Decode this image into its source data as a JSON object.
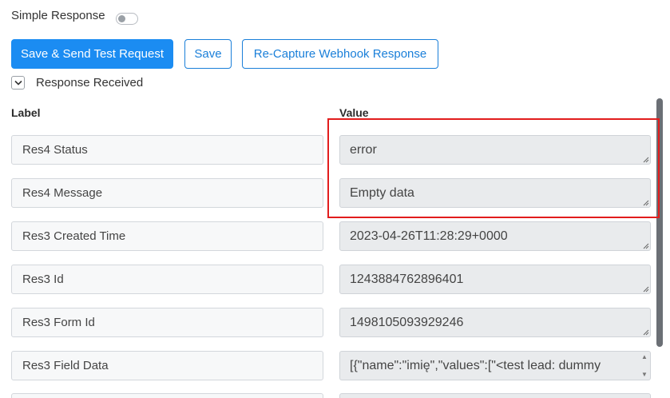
{
  "simple_response": {
    "label": "Simple Response",
    "enabled": false
  },
  "buttons": {
    "save_send": "Save & Send Test Request",
    "save": "Save",
    "recapture": "Re-Capture Webhook Response"
  },
  "response_section": {
    "label": "Response Received",
    "expanded": true
  },
  "columns": {
    "label": "Label",
    "value": "Value"
  },
  "rows": [
    {
      "label": "Res4 Status",
      "value": "error"
    },
    {
      "label": "Res4 Message",
      "value": "Empty data"
    },
    {
      "label": "Res3 Created Time",
      "value": "2023-04-26T11:28:29+0000"
    },
    {
      "label": "Res3 Id",
      "value": "1243884762896401"
    },
    {
      "label": "Res3 Form Id",
      "value": "1498105093929246"
    },
    {
      "label": "Res3 Field Data",
      "value": "[{\"name\":\"imię\",\"values\":[\"<test lead: dummy"
    }
  ],
  "colors": {
    "primary": "#1b8cf2",
    "highlight": "#e21d1d",
    "value_bg": "#e9ebed"
  }
}
